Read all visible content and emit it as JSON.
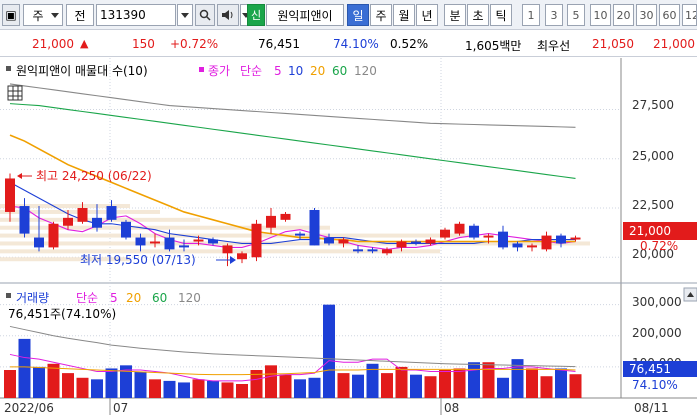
{
  "toolbar": {
    "period": "주",
    "jeon": "전",
    "code": "131390",
    "search_icon": "search-icon",
    "speaker_icon": "speaker-icon",
    "shin": "신",
    "stock_name": "원익피앤이",
    "timeframes": [
      "일",
      "주",
      "월",
      "년",
      "분",
      "초",
      "틱"
    ],
    "selected_timeframe": "일",
    "intervals": [
      "1",
      "3",
      "5",
      "10",
      "20",
      "30",
      "60",
      "12"
    ]
  },
  "quote": {
    "price": "21,000",
    "change": "150",
    "change_pct": "+0.72%",
    "volume": "76,451",
    "volume_ratio": "74.10%",
    "turnover_pct": "0.52%",
    "amount": "1,605백만",
    "best_ask_label": "최우선",
    "best_ask": "21,050",
    "best_bid": "21,000"
  },
  "colors": {
    "up": "#e21b1b",
    "down": "#1d3fd6",
    "ma5": "#e01fe0",
    "ma10": "#1d3fd6",
    "ma20": "#f0a000",
    "ma60": "#1aa54a",
    "ma120": "#888888"
  },
  "price_legend": {
    "name": "원익피앤이 매물대 수(10)",
    "close": "종가",
    "type": "단순",
    "ma5": "5",
    "ma10": "10",
    "ma20": "20",
    "ma60": "60",
    "ma120": "120"
  },
  "annotations": {
    "high": "최고 24,250 (06/22)",
    "low": "최저 19,550 (07/13)"
  },
  "volume_legend": {
    "name": "거래량",
    "type": "단순",
    "ma5": "5",
    "ma20": "20",
    "ma60": "60",
    "ma120": "120",
    "current": "76,451주(74.10%)"
  },
  "price_axis": {
    "ticks": [
      "27,500",
      "25,000",
      "22,500",
      "20,000"
    ],
    "current": "21,000",
    "current_pct": "0.72%"
  },
  "volume_axis": {
    "ticks": [
      "300,000",
      "200,000",
      "100,000"
    ],
    "current": "76,451",
    "current_pct": "74.10%"
  },
  "x_axis": {
    "labels": [
      "2022/06",
      "07",
      "08"
    ],
    "right_label": "08/11"
  },
  "chart_data": [
    {
      "type": "candlestick",
      "title": "원익피앤이 매물대 수(10)",
      "ylim": [
        19200,
        29000
      ],
      "candles": [
        {
          "o": 22300,
          "h": 24250,
          "l": 21800,
          "c": 24000
        },
        {
          "o": 22600,
          "h": 23000,
          "l": 21000,
          "c": 21200
        },
        {
          "o": 21000,
          "h": 22600,
          "l": 20300,
          "c": 20500
        },
        {
          "o": 20500,
          "h": 21800,
          "l": 20400,
          "c": 21700
        },
        {
          "o": 21600,
          "h": 22400,
          "l": 21400,
          "c": 22000
        },
        {
          "o": 21800,
          "h": 22800,
          "l": 21700,
          "c": 22500
        },
        {
          "o": 22000,
          "h": 22700,
          "l": 21300,
          "c": 21500
        },
        {
          "o": 22600,
          "h": 22900,
          "l": 21800,
          "c": 21900
        },
        {
          "o": 21800,
          "h": 21900,
          "l": 20900,
          "c": 21000
        },
        {
          "o": 21000,
          "h": 21200,
          "l": 20300,
          "c": 20600
        },
        {
          "o": 20700,
          "h": 21200,
          "l": 20500,
          "c": 20800
        },
        {
          "o": 21000,
          "h": 21400,
          "l": 20300,
          "c": 20400
        },
        {
          "o": 20600,
          "h": 20900,
          "l": 20300,
          "c": 20500
        },
        {
          "o": 20800,
          "h": 21100,
          "l": 20600,
          "c": 20900
        },
        {
          "o": 20900,
          "h": 21000,
          "l": 20600,
          "c": 20700
        },
        {
          "o": 20200,
          "h": 20700,
          "l": 19550,
          "c": 20600
        },
        {
          "o": 19900,
          "h": 20300,
          "l": 19700,
          "c": 20200
        },
        {
          "o": 20000,
          "h": 21900,
          "l": 19800,
          "c": 21700
        },
        {
          "o": 21500,
          "h": 22500,
          "l": 21200,
          "c": 22100
        },
        {
          "o": 21900,
          "h": 22300,
          "l": 21800,
          "c": 22200
        },
        {
          "o": 21200,
          "h": 21300,
          "l": 20900,
          "c": 21100
        },
        {
          "o": 22400,
          "h": 22500,
          "l": 20600,
          "c": 20600
        },
        {
          "o": 21000,
          "h": 21200,
          "l": 20600,
          "c": 20700
        },
        {
          "o": 20700,
          "h": 21000,
          "l": 20500,
          "c": 20900
        },
        {
          "o": 20400,
          "h": 20600,
          "l": 20200,
          "c": 20300
        },
        {
          "o": 20400,
          "h": 20500,
          "l": 20200,
          "c": 20300
        },
        {
          "o": 20200,
          "h": 20500,
          "l": 20100,
          "c": 20400
        },
        {
          "o": 20500,
          "h": 20900,
          "l": 20300,
          "c": 20800
        },
        {
          "o": 20800,
          "h": 20900,
          "l": 20600,
          "c": 20700
        },
        {
          "o": 20700,
          "h": 21000,
          "l": 20600,
          "c": 20900
        },
        {
          "o": 21000,
          "h": 21500,
          "l": 20900,
          "c": 21400
        },
        {
          "o": 21200,
          "h": 21800,
          "l": 21100,
          "c": 21700
        },
        {
          "o": 21600,
          "h": 21700,
          "l": 20900,
          "c": 21000
        },
        {
          "o": 21000,
          "h": 21200,
          "l": 20700,
          "c": 21100
        },
        {
          "o": 21300,
          "h": 21600,
          "l": 20400,
          "c": 20500
        },
        {
          "o": 20700,
          "h": 20800,
          "l": 20300,
          "c": 20500
        },
        {
          "o": 20500,
          "h": 20700,
          "l": 20300,
          "c": 20600
        },
        {
          "o": 20400,
          "h": 21300,
          "l": 20300,
          "c": 21100
        },
        {
          "o": 21100,
          "h": 21200,
          "l": 20500,
          "c": 20700
        },
        {
          "o": 20900,
          "h": 21100,
          "l": 20800,
          "c": 21000
        }
      ],
      "ma_series": [
        {
          "name": "5",
          "values": [
            22600,
            22500,
            22000,
            21700,
            21400,
            21300,
            21600,
            22000,
            22100,
            21700,
            21200,
            20900,
            20700,
            20700,
            20600,
            20500,
            20500,
            20700,
            21000,
            21300,
            21400,
            21200,
            21000,
            20800,
            20600,
            20500,
            20400,
            20500,
            20500,
            20600,
            20800,
            21000,
            21100,
            21200,
            21100,
            21000,
            20900,
            20800,
            20700,
            20800
          ]
        },
        {
          "name": "10",
          "values": [
            23800,
            23400,
            23000,
            22600,
            22200,
            21900,
            21700,
            21700,
            21600,
            21500,
            21400,
            21200,
            21100,
            21000,
            20900,
            20800,
            20700,
            20700,
            20700,
            20800,
            20900,
            20900,
            21000,
            21000,
            20900,
            20800,
            20700,
            20700,
            20700,
            20700,
            20700,
            20700,
            20700,
            20800,
            20800,
            20800,
            20900,
            20900,
            20900,
            20900
          ]
        },
        {
          "name": "20",
          "values": [
            26200,
            25900,
            25500,
            25100,
            24700,
            24400,
            24100,
            23800,
            23500,
            23200,
            22900,
            22600,
            22300,
            22100,
            21900,
            21700,
            21500,
            21300,
            21200,
            21100,
            21000,
            21000,
            20900,
            20900,
            20800,
            20800,
            20800,
            20800,
            20800,
            20800,
            20800,
            20800,
            20800,
            20800,
            20800,
            20800,
            20800,
            20800,
            20800,
            20800
          ]
        },
        {
          "name": "60",
          "values": [
            27800,
            27750,
            27700,
            27600,
            27500,
            27400,
            27300,
            27200,
            27100,
            27000,
            26900,
            26800,
            26700,
            26600,
            26500,
            26400,
            26300,
            26200,
            26100,
            26000,
            25900,
            25800,
            25700,
            25600,
            25500,
            25400,
            25300,
            25200,
            25100,
            25000,
            24900,
            24800,
            24700,
            24600,
            24500,
            24400,
            24300,
            24200,
            24100,
            24000
          ]
        },
        {
          "name": "120",
          "values": [
            28800,
            28700,
            28600,
            28500,
            28400,
            28300,
            28200,
            28100,
            28000,
            27900,
            27800,
            27700,
            27650,
            27600,
            27550,
            27500,
            27450,
            27400,
            27350,
            27300,
            27250,
            27200,
            27150,
            27100,
            27050,
            27000,
            26950,
            26900,
            26850,
            26800,
            26780,
            26760,
            26740,
            26720,
            26700,
            26680,
            26660,
            26640,
            26620,
            26600
          ]
        }
      ]
    },
    {
      "type": "bar",
      "title": "거래량",
      "ylim": [
        0,
        360000
      ],
      "values": [
        90000,
        190000,
        100000,
        110000,
        80000,
        65000,
        60000,
        95000,
        105000,
        85000,
        60000,
        55000,
        50000,
        60000,
        55000,
        50000,
        45000,
        90000,
        105000,
        75000,
        60000,
        65000,
        300000,
        80000,
        75000,
        110000,
        80000,
        100000,
        75000,
        70000,
        90000,
        95000,
        115000,
        115000,
        65000,
        125000,
        95000,
        70000,
        95000,
        76451
      ],
      "ma_series": [
        {
          "name": "5",
          "values": [
            140000,
            130000,
            125000,
            115000,
            105000,
            95000,
            85000,
            85000,
            90000,
            90000,
            85000,
            80000,
            70000,
            60000,
            55000,
            55000,
            55000,
            60000,
            70000,
            75000,
            75000,
            80000,
            120000,
            115000,
            115000,
            125000,
            125000,
            90000,
            90000,
            85000,
            85000,
            85000,
            90000,
            95000,
            95000,
            100000,
            100000,
            95000,
            90000,
            85000
          ]
        },
        {
          "name": "20",
          "values": [
            100000,
            100000,
            98000,
            96000,
            94000,
            92000,
            90000,
            88000,
            86000,
            84000,
            82000,
            80000,
            78000,
            76000,
            75000,
            75000,
            75000,
            76000,
            77000,
            78000,
            80000,
            82000,
            90000,
            90000,
            90000,
            92000,
            92000,
            92000,
            92000,
            92000,
            92000,
            92000,
            92000,
            92000,
            92000,
            92000,
            92000,
            92000,
            92000,
            90000
          ]
        },
        {
          "name": "60",
          "values": [
            230000,
            220000,
            210000,
            200000,
            192000,
            185000,
            178000,
            170000,
            165000,
            160000,
            156000,
            152000,
            148000,
            145000,
            142000,
            140000,
            138000,
            136000,
            134000,
            132000,
            130000,
            128000,
            126000,
            124000,
            122000,
            120000,
            118000,
            116000,
            114000,
            112000,
            110000,
            109000,
            108000,
            107000,
            106000,
            105000,
            104000,
            103000,
            102000,
            101000
          ]
        }
      ]
    }
  ]
}
